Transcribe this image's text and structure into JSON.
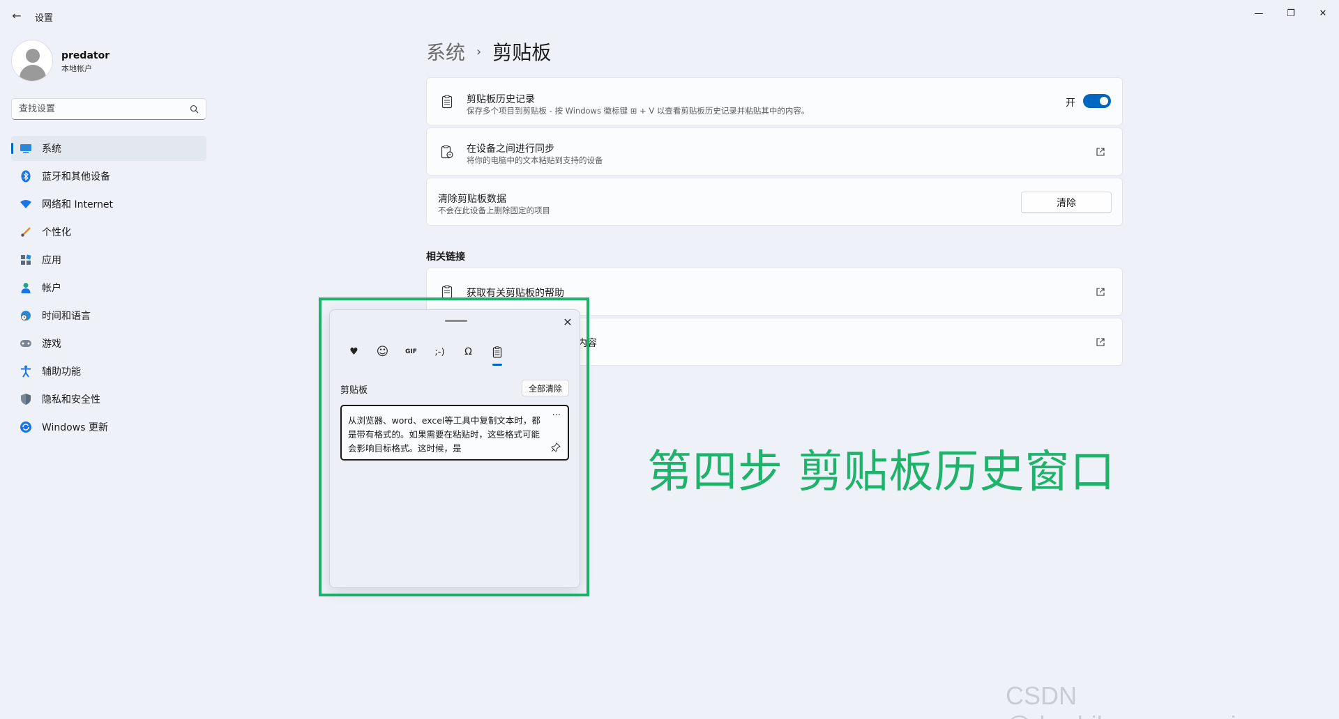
{
  "app": {
    "title": "设置"
  },
  "window": {
    "minimize": "—",
    "maximize": "❐",
    "close": "✕"
  },
  "user": {
    "name": "predator",
    "account_type": "本地帐户"
  },
  "search": {
    "placeholder": "查找设置"
  },
  "sidebar": {
    "items": [
      {
        "label": "系统",
        "icon": "system-icon",
        "selected": true
      },
      {
        "label": "蓝牙和其他设备",
        "icon": "bluetooth-icon"
      },
      {
        "label": "网络和 Internet",
        "icon": "wifi-icon"
      },
      {
        "label": "个性化",
        "icon": "brush-icon"
      },
      {
        "label": "应用",
        "icon": "apps-icon"
      },
      {
        "label": "帐户",
        "icon": "person-icon"
      },
      {
        "label": "时间和语言",
        "icon": "globe-clock-icon"
      },
      {
        "label": "游戏",
        "icon": "gamepad-icon"
      },
      {
        "label": "辅助功能",
        "icon": "accessibility-icon"
      },
      {
        "label": "隐私和安全性",
        "icon": "shield-icon"
      },
      {
        "label": "Windows 更新",
        "icon": "update-icon"
      }
    ]
  },
  "breadcrumb": {
    "parent": "系统",
    "separator": "›",
    "current": "剪贴板"
  },
  "cards": {
    "history": {
      "title": "剪贴板历史记录",
      "subtitle": "保存多个项目到剪贴板 - 按 Windows 徽标键 ⊞ + V 以查看剪贴板历史记录并粘贴其中的内容。",
      "toggle_label": "开",
      "toggle_on": true
    },
    "sync": {
      "title": "在设备之间进行同步",
      "subtitle": "将你的电脑中的文本粘贴到支持的设备"
    },
    "clear": {
      "title": "清除剪贴板数据",
      "subtitle": "不会在此设备上删除固定的项目",
      "button": "清除"
    }
  },
  "related": {
    "title": "相关链接",
    "items": [
      {
        "label": "获取有关剪贴板的帮助"
      },
      {
        "label": "内容"
      }
    ]
  },
  "clipboard_panel": {
    "close": "✕",
    "tabs": [
      {
        "icon": "sticker-icon",
        "glyph": "♥"
      },
      {
        "icon": "emoji-icon",
        "glyph": "☺"
      },
      {
        "icon": "gif-icon",
        "glyph": "GIF"
      },
      {
        "icon": "kaomoji-icon",
        "glyph": ";-)"
      },
      {
        "icon": "symbols-icon",
        "glyph": "Ω"
      },
      {
        "icon": "clipboard-icon",
        "glyph": "📋",
        "active": true
      }
    ],
    "section_title": "剪贴板",
    "clear_all": "全部清除",
    "item_text": "从浏览器、word、excel等工具中复制文本时，都是带有格式的。如果需要在粘贴时，这些格式可能会影响目标格式。这时候，是",
    "item_more": "···"
  },
  "caption": "第四步 剪贴板历史窗口",
  "watermark": "CSDN @dowhileprogramming",
  "colors": {
    "accent": "#0067c0",
    "highlight": "#1fb26b",
    "background": "#eef2f8"
  }
}
